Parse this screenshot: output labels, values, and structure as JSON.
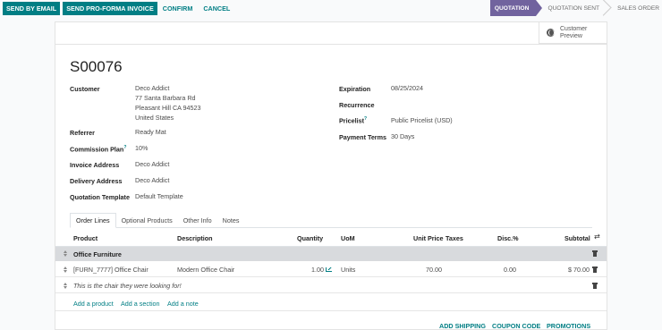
{
  "actions": {
    "send_by_email": "SEND BY EMAIL",
    "send_pro_forma": "SEND PRO-FORMA INVOICE",
    "confirm": "CONFIRM",
    "cancel": "CANCEL"
  },
  "status": {
    "stages": [
      "QUOTATION",
      "QUOTATION SENT",
      "SALES ORDER"
    ],
    "active": "QUOTATION"
  },
  "preview": {
    "line1": "Customer",
    "line2": "Preview",
    "icon": "globe-icon"
  },
  "order": {
    "name": "S00076"
  },
  "left_fields": {
    "customer_label": "Customer",
    "customer_name": "Deco Addict",
    "customer_street": "77 Santa Barbara Rd",
    "customer_city": "Pleasant Hill CA 94523",
    "customer_country": "United States",
    "referrer_label": "Referrer",
    "referrer_value": "Ready Mat",
    "commission_label": "Commission Plan",
    "commission_sup": "?",
    "commission_value": "10%",
    "invoice_label": "Invoice Address",
    "invoice_value": "Deco Addict",
    "delivery_label": "Delivery Address",
    "delivery_value": "Deco Addict",
    "template_label": "Quotation Template",
    "template_value": "Default Template"
  },
  "right_fields": {
    "expiration_label": "Expiration",
    "expiration_value": "08/25/2024",
    "recurrence_label": "Recurrence",
    "pricelist_label": "Pricelist",
    "pricelist_sup": "?",
    "pricelist_value": "Public Pricelist (USD)",
    "payment_label": "Payment Terms",
    "payment_value": "30 Days"
  },
  "tabs": [
    "Order Lines",
    "Optional Products",
    "Other Info",
    "Notes"
  ],
  "columns": {
    "product": "Product",
    "description": "Description",
    "quantity": "Quantity",
    "uom": "UoM",
    "unit_price": "Unit Price",
    "taxes": "Taxes",
    "discount": "Disc.%",
    "subtotal": "Subtotal"
  },
  "lines": {
    "section": "Office Furniture",
    "product": {
      "name": "[FURN_7777] Office Chair",
      "description": "Modern Office Chair",
      "quantity": "1.00",
      "uom": "Units",
      "unit_price": "70.00",
      "discount": "0.00",
      "subtotal": "$ 70.00"
    },
    "note": "This is the chair they were looking for!"
  },
  "add_links": {
    "product": "Add a product",
    "section": "Add a section",
    "note": "Add a note"
  },
  "footer": {
    "shipping": "ADD SHIPPING",
    "coupon": "COUPON CODE",
    "promotions": "PROMOTIONS"
  },
  "colors": {
    "primary": "#017e84",
    "stage_active": "#71639e",
    "section_bg": "#d8dadd"
  }
}
